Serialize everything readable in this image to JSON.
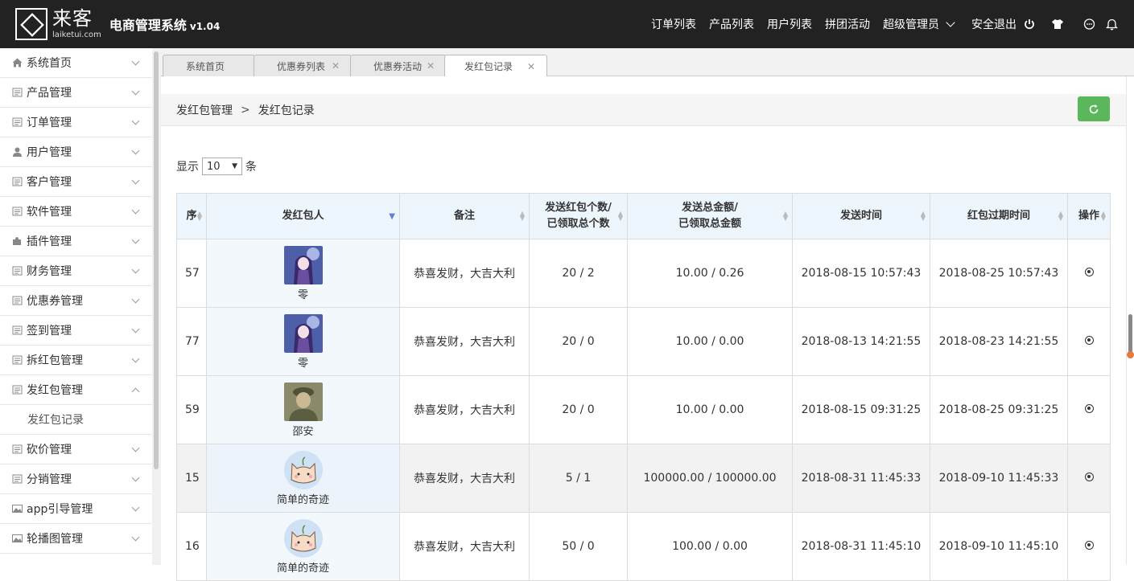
{
  "header": {
    "logo_cn": "来客",
    "logo_en": "laiketui.com",
    "title": "电商管理系统",
    "version": "v1.04",
    "nav": [
      "订单列表",
      "产品列表",
      "用户列表",
      "拼团活动",
      "超级管理员",
      "安全退出"
    ],
    "icons": [
      "power-icon",
      "tshirt-icon",
      "chat-icon",
      "bell-icon"
    ]
  },
  "sidebar": {
    "items": [
      {
        "label": "系统首页",
        "icon": "home-icon"
      },
      {
        "label": "产品管理",
        "icon": "bag-icon"
      },
      {
        "label": "订单管理",
        "icon": "list-icon"
      },
      {
        "label": "用户管理",
        "icon": "user-icon"
      },
      {
        "label": "客户管理",
        "icon": "customer-icon"
      },
      {
        "label": "软件管理",
        "icon": "grid-icon"
      },
      {
        "label": "插件管理",
        "icon": "puzzle-icon"
      },
      {
        "label": "财务管理",
        "icon": "finance-icon"
      },
      {
        "label": "优惠券管理",
        "icon": "coupon-icon"
      },
      {
        "label": "签到管理",
        "icon": "signin-icon"
      },
      {
        "label": "拆红包管理",
        "icon": "redpack-icon"
      },
      {
        "label": "发红包管理",
        "icon": "send-redpack-icon",
        "expanded": true
      },
      {
        "label": "砍价管理",
        "icon": "bargain-icon"
      },
      {
        "label": "分销管理",
        "icon": "distribution-icon"
      },
      {
        "label": "app引导管理",
        "icon": "image-icon"
      },
      {
        "label": "轮播图管理",
        "icon": "image-icon"
      }
    ],
    "sub_item": "发红包记录"
  },
  "tabs": [
    {
      "label": "系统首页"
    },
    {
      "label": "优惠券列表"
    },
    {
      "label": "优惠券活动"
    },
    {
      "label": "发红包记录",
      "active": true
    }
  ],
  "breadcrumb": {
    "parent": "发红包管理",
    "sep": ">",
    "current": "发红包记录"
  },
  "page_size": {
    "prefix": "显示",
    "value": "10",
    "suffix": "条"
  },
  "table": {
    "headers": [
      "序",
      "发红包人",
      "备注",
      "发送红包个数/\n已领取总个数",
      "发送总金额/\n已领取总金额",
      "发送时间",
      "红包过期时间",
      "操作"
    ],
    "rows": [
      {
        "id": "57",
        "sender": "零",
        "note": "恭喜发财，大吉大利",
        "count": "20 / 2",
        "amount": "10.00 / 0.26",
        "send_time": "2018-08-15 10:57:43",
        "expire_time": "2018-08-25 10:57:43",
        "avatar": "anime-girl"
      },
      {
        "id": "77",
        "sender": "零",
        "note": "恭喜发财，大吉大利",
        "count": "20 / 0",
        "amount": "10.00 / 0.00",
        "send_time": "2018-08-13 14:21:55",
        "expire_time": "2018-08-23 14:21:55",
        "avatar": "anime-girl"
      },
      {
        "id": "59",
        "sender": "邵安",
        "note": "恭喜发财，大吉大利",
        "count": "20 / 0",
        "amount": "10.00 / 0.00",
        "send_time": "2018-08-15 09:31:25",
        "expire_time": "2018-08-25 09:31:25",
        "avatar": "soldier-photo"
      },
      {
        "id": "15",
        "sender": "简单的奇迹",
        "note": "恭喜发财，大吉大利",
        "count": "5 / 1",
        "amount": "100000.00 / 100000.00",
        "send_time": "2018-08-31 11:45:33",
        "expire_time": "2018-09-10 11:45:33",
        "avatar": "cat-cartoon"
      },
      {
        "id": "16",
        "sender": "简单的奇迹",
        "note": "恭喜发财，大吉大利",
        "count": "50 / 0",
        "amount": "100.00 / 0.00",
        "send_time": "2018-08-31 11:45:10",
        "expire_time": "2018-09-10 11:45:10",
        "avatar": "cat-cartoon"
      }
    ]
  },
  "colors": {
    "header_bg": "#222222",
    "refresh_btn": "#5bb75b",
    "th_bg": "#eef6fd",
    "sort_active": "#6a7ad8"
  }
}
